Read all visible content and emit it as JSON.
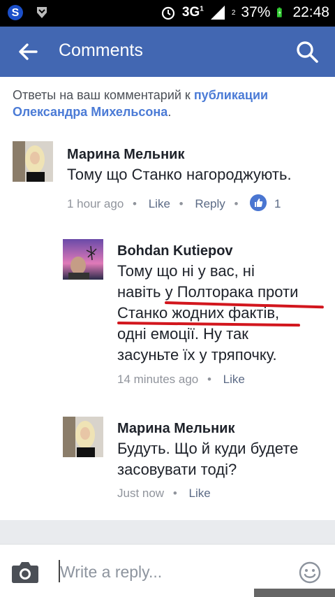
{
  "status_bar": {
    "network_label": "3G",
    "sim1": "1",
    "sim2": "2",
    "battery": "37%",
    "time": "22:48",
    "icons": [
      "app-s-icon",
      "shield-icon",
      "alarm-icon",
      "signal-icon",
      "battery-icon"
    ]
  },
  "app_bar": {
    "title": "Comments",
    "color": "#4267b2"
  },
  "header": {
    "prefix": "Ответы на ваш комментарий к ",
    "link": "публикации Олександра Михельсона",
    "suffix": "."
  },
  "comments": [
    {
      "author": "Марина Мельник",
      "text": "Тому що Станко нагороджують.",
      "time": "1 hour ago",
      "like": "Like",
      "reply": "Reply",
      "like_count": "1"
    },
    {
      "author": "Bohdan Kutiepov",
      "lines": [
        "Тому що ні у вас, ні",
        "навіть у Полторака проти",
        "Станко жодних фактів,",
        "одні емоції. Ну так",
        "засуньте їх у тряпочку."
      ],
      "time": "14 minutes ago",
      "like": "Like"
    },
    {
      "author": "Марина Мельник",
      "lines": [
        "Будуть. Що й куди будете",
        "засовувати тоді?"
      ],
      "time": "Just now",
      "like": "Like"
    }
  ],
  "composer": {
    "placeholder": "Write a reply..."
  },
  "colors": {
    "accent": "#4267b2",
    "link": "#4b7bd6",
    "underline": "#d2161d"
  }
}
